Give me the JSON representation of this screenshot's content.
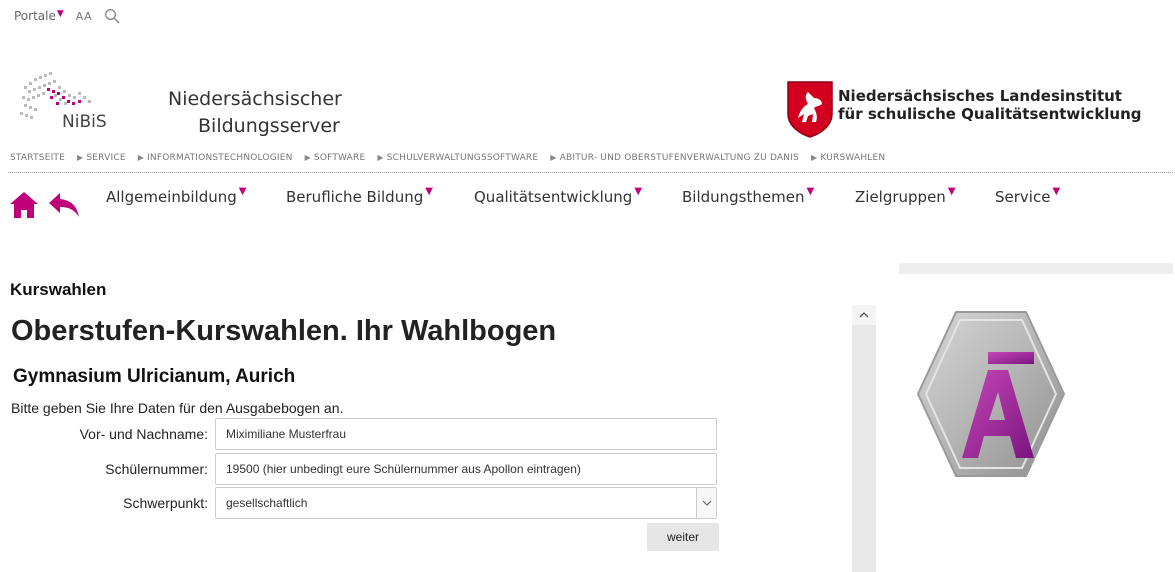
{
  "topbar": {
    "portale_label": "Portale",
    "font_size_label": "AA",
    "search_icon": "search-icon"
  },
  "header": {
    "nibis_short": "NiBiS",
    "server_line1": "Niedersächsischer",
    "server_line2": "Bildungsserver",
    "institute_line1": "Niedersächsisches Landesinstitut",
    "institute_line2": "für schulische Qualitätsentwicklung"
  },
  "breadcrumb": [
    "STARTSEITE",
    "SERVICE",
    "INFORMATIONSTECHNOLOGIEN",
    "SOFTWARE",
    "SCHULVERWALTUNGSSOFTWARE",
    "ABITUR- UND OBERSTUFENVERWALTUNG ZU DANIS",
    "KURSWAHLEN"
  ],
  "nav": {
    "items": [
      "Allgemeinbildung",
      "Berufliche Bildung",
      "Qualitätsentwicklung",
      "Bildungsthemen",
      "Zielgruppen",
      "Service"
    ]
  },
  "content": {
    "section_heading": "Kurswahlen",
    "title": "Oberstufen-Kurswahlen. Ihr Wahlbogen",
    "school": "Gymnasium Ulricianum, Aurich",
    "instructions": "Bitte geben Sie Ihre Daten für den Ausgabebogen an."
  },
  "form": {
    "name_label": "Vor- und Nachname:",
    "name_value": "Miximiliane Musterfrau",
    "number_label": "Schülernummer:",
    "number_value": "19500  (hier unbedingt eure Schülernummer aus Apollon eintragen)",
    "focus_label": "Schwerpunkt:",
    "focus_value": "gesellschaftlich",
    "submit_label": "weiter"
  },
  "colors": {
    "accent": "#c0007a",
    "text": "#333333"
  }
}
